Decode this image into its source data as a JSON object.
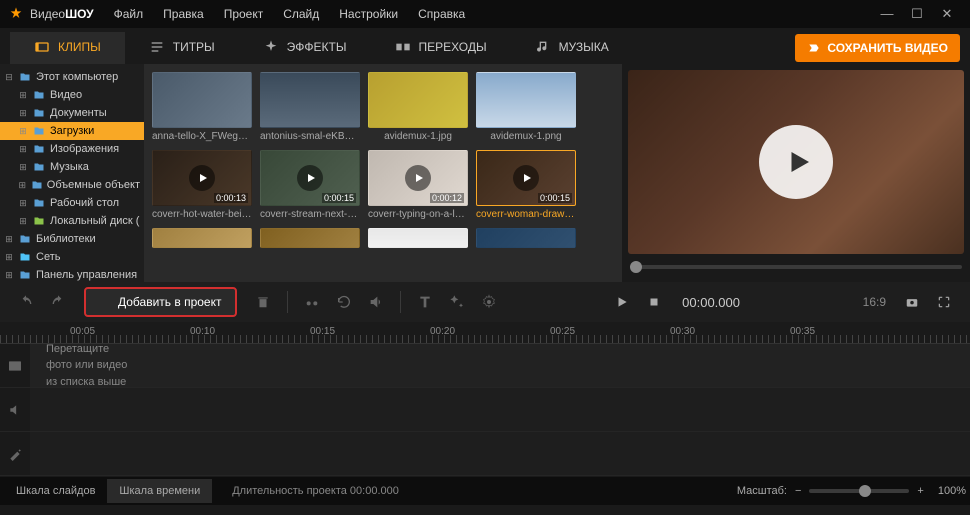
{
  "app": {
    "title_part1": "Видео",
    "title_part2": "ШОУ"
  },
  "menu": [
    "Файл",
    "Правка",
    "Проект",
    "Слайд",
    "Настройки",
    "Справка"
  ],
  "tabs": [
    {
      "label": "КЛИПЫ",
      "active": true
    },
    {
      "label": "ТИТРЫ",
      "active": false
    },
    {
      "label": "ЭФФЕКТЫ",
      "active": false
    },
    {
      "label": "ПЕРЕХОДЫ",
      "active": false
    },
    {
      "label": "МУЗЫКА",
      "active": false
    }
  ],
  "save_btn": "СОХРАНИТЬ ВИДЕО",
  "tree": [
    {
      "label": "Этот компьютер",
      "indent": 0,
      "icon": "computer",
      "expanded": true
    },
    {
      "label": "Видео",
      "indent": 1,
      "icon": "folder"
    },
    {
      "label": "Документы",
      "indent": 1,
      "icon": "folder"
    },
    {
      "label": "Загрузки",
      "indent": 1,
      "icon": "folder",
      "selected": true
    },
    {
      "label": "Изображения",
      "indent": 1,
      "icon": "folder"
    },
    {
      "label": "Музыка",
      "indent": 1,
      "icon": "folder"
    },
    {
      "label": "Объемные объект",
      "indent": 1,
      "icon": "folder"
    },
    {
      "label": "Рабочий стол",
      "indent": 1,
      "icon": "folder"
    },
    {
      "label": "Локальный диск (",
      "indent": 1,
      "icon": "drive"
    },
    {
      "label": "Библиотеки",
      "indent": 0,
      "icon": "lib"
    },
    {
      "label": "Сеть",
      "indent": 0,
      "icon": "net"
    },
    {
      "label": "Панель управления",
      "indent": 0,
      "icon": "panel"
    }
  ],
  "thumbs": [
    {
      "label": "anna-tello-X_FWega1EU0-...",
      "bg": "linear-gradient(135deg,#4a5a6a,#6a7a8a)",
      "video": false
    },
    {
      "label": "antonius-smal-eKB0NmlUe...",
      "bg": "linear-gradient(180deg,#3a4a5a,#5a6a7a)",
      "video": false
    },
    {
      "label": "avidemux-1.jpg",
      "bg": "linear-gradient(135deg,#b8a030,#d0c040)",
      "video": false
    },
    {
      "label": "avidemux-1.png",
      "bg": "linear-gradient(180deg,#88aacc,#c8d8e8)",
      "video": false
    },
    {
      "label": "coverr-hot-water-being-p...",
      "bg": "linear-gradient(135deg,#2a2018,#4a3828)",
      "video": true,
      "duration": "0:00:13"
    },
    {
      "label": "coverr-stream-next-to-the...",
      "bg": "linear-gradient(135deg,#384838,#506050)",
      "video": true,
      "duration": "0:00:15"
    },
    {
      "label": "coverr-typing-on-a-laptop...",
      "bg": "linear-gradient(135deg,#c0b8b0,#e0d8d0)",
      "video": true,
      "duration": "0:00:12"
    },
    {
      "label": "coverr-woman-drawing-in-...",
      "bg": "linear-gradient(135deg,#3a2818,#5a4030)",
      "video": true,
      "duration": "0:00:15",
      "selected": true
    },
    {
      "label": "",
      "bg": "linear-gradient(135deg,#a08040,#c0a060)",
      "video": false,
      "partial": true
    },
    {
      "label": "",
      "bg": "linear-gradient(135deg,#806020,#a08040)",
      "video": false,
      "partial": true
    },
    {
      "label": "",
      "bg": "linear-gradient(180deg,#e8e8e8,#f0f0f0)",
      "video": false,
      "partial": true
    },
    {
      "label": "",
      "bg": "linear-gradient(135deg,#204060,#305070)",
      "video": false,
      "partial": true
    }
  ],
  "add_project": "Добавить в проект",
  "timecode": "00:00.000",
  "aspect": "16:9",
  "ruler_ticks": [
    {
      "label": "00:05",
      "pos": 40
    },
    {
      "label": "00:10",
      "pos": 160
    },
    {
      "label": "00:15",
      "pos": 280
    },
    {
      "label": "00:20",
      "pos": 400
    },
    {
      "label": "00:25",
      "pos": 520
    },
    {
      "label": "00:30",
      "pos": 640
    },
    {
      "label": "00:35",
      "pos": 760
    }
  ],
  "placeholder": {
    "l1": "Перетащите",
    "l2": "фото или видео",
    "l3": "из списка выше"
  },
  "status": {
    "tab1": "Шкала слайдов",
    "tab2": "Шкала времени",
    "duration_label": "Длительность проекта",
    "duration_value": "00:00.000",
    "scale_label": "Масштаб:",
    "zoom_pct": "100%"
  }
}
